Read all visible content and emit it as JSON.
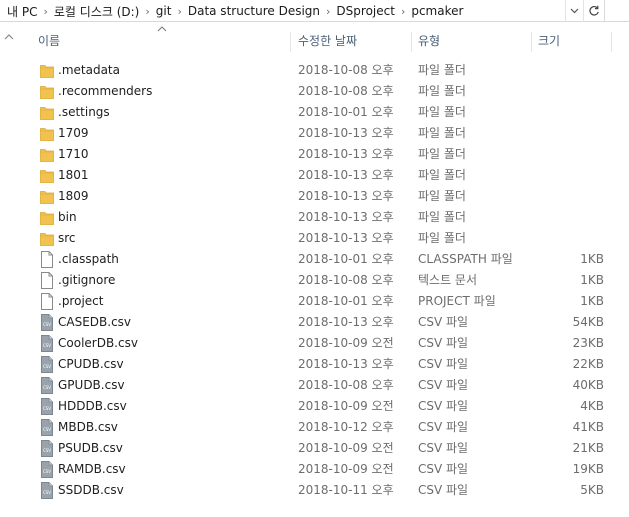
{
  "address": {
    "crumbs": [
      "내 PC",
      "로컬 디스크 (D:)",
      "git",
      "Data structure Design",
      "DSproject",
      "pcmaker"
    ]
  },
  "columns": {
    "name": "이름",
    "modified": "수정한 날짜",
    "type": "유형",
    "size": "크기"
  },
  "files": [
    {
      "name": ".metadata",
      "modified": "2018-10-08 오후",
      "type": "파일 폴더",
      "size": "",
      "kind": "folder"
    },
    {
      "name": ".recommenders",
      "modified": "2018-10-08 오후",
      "type": "파일 폴더",
      "size": "",
      "kind": "folder"
    },
    {
      "name": ".settings",
      "modified": "2018-10-01 오후",
      "type": "파일 폴더",
      "size": "",
      "kind": "folder"
    },
    {
      "name": "1709",
      "modified": "2018-10-13 오후",
      "type": "파일 폴더",
      "size": "",
      "kind": "folder"
    },
    {
      "name": "1710",
      "modified": "2018-10-13 오후",
      "type": "파일 폴더",
      "size": "",
      "kind": "folder"
    },
    {
      "name": "1801",
      "modified": "2018-10-13 오후",
      "type": "파일 폴더",
      "size": "",
      "kind": "folder"
    },
    {
      "name": "1809",
      "modified": "2018-10-13 오후",
      "type": "파일 폴더",
      "size": "",
      "kind": "folder"
    },
    {
      "name": "bin",
      "modified": "2018-10-13 오후",
      "type": "파일 폴더",
      "size": "",
      "kind": "folder"
    },
    {
      "name": "src",
      "modified": "2018-10-13 오후",
      "type": "파일 폴더",
      "size": "",
      "kind": "folder"
    },
    {
      "name": ".classpath",
      "modified": "2018-10-01 오후",
      "type": "CLASSPATH 파일",
      "size": "1KB",
      "kind": "file"
    },
    {
      "name": ".gitignore",
      "modified": "2018-10-08 오후",
      "type": "텍스트 문서",
      "size": "1KB",
      "kind": "file"
    },
    {
      "name": ".project",
      "modified": "2018-10-01 오후",
      "type": "PROJECT 파일",
      "size": "1KB",
      "kind": "file"
    },
    {
      "name": "CASEDB.csv",
      "modified": "2018-10-13 오후",
      "type": "CSV 파일",
      "size": "54KB",
      "kind": "csv"
    },
    {
      "name": "CoolerDB.csv",
      "modified": "2018-10-09 오전",
      "type": "CSV 파일",
      "size": "23KB",
      "kind": "csv"
    },
    {
      "name": "CPUDB.csv",
      "modified": "2018-10-13 오후",
      "type": "CSV 파일",
      "size": "22KB",
      "kind": "csv"
    },
    {
      "name": "GPUDB.csv",
      "modified": "2018-10-08 오후",
      "type": "CSV 파일",
      "size": "40KB",
      "kind": "csv"
    },
    {
      "name": "HDDDB.csv",
      "modified": "2018-10-09 오전",
      "type": "CSV 파일",
      "size": "4KB",
      "kind": "csv"
    },
    {
      "name": "MBDB.csv",
      "modified": "2018-10-12 오후",
      "type": "CSV 파일",
      "size": "41KB",
      "kind": "csv"
    },
    {
      "name": "PSUDB.csv",
      "modified": "2018-10-09 오전",
      "type": "CSV 파일",
      "size": "21KB",
      "kind": "csv"
    },
    {
      "name": "RAMDB.csv",
      "modified": "2018-10-09 오전",
      "type": "CSV 파일",
      "size": "19KB",
      "kind": "csv"
    },
    {
      "name": "SSDDB.csv",
      "modified": "2018-10-11 오후",
      "type": "CSV 파일",
      "size": "5KB",
      "kind": "csv"
    }
  ],
  "icons": {
    "folder": "folder-icon",
    "file": "file-icon",
    "csv": "csv-file-icon",
    "refresh": "refresh-icon",
    "dropdown": "chevron-down-icon"
  },
  "colors": {
    "folder": "#f2c24f",
    "header_text": "#4c607a",
    "secondary_text": "#6d6d6d"
  }
}
